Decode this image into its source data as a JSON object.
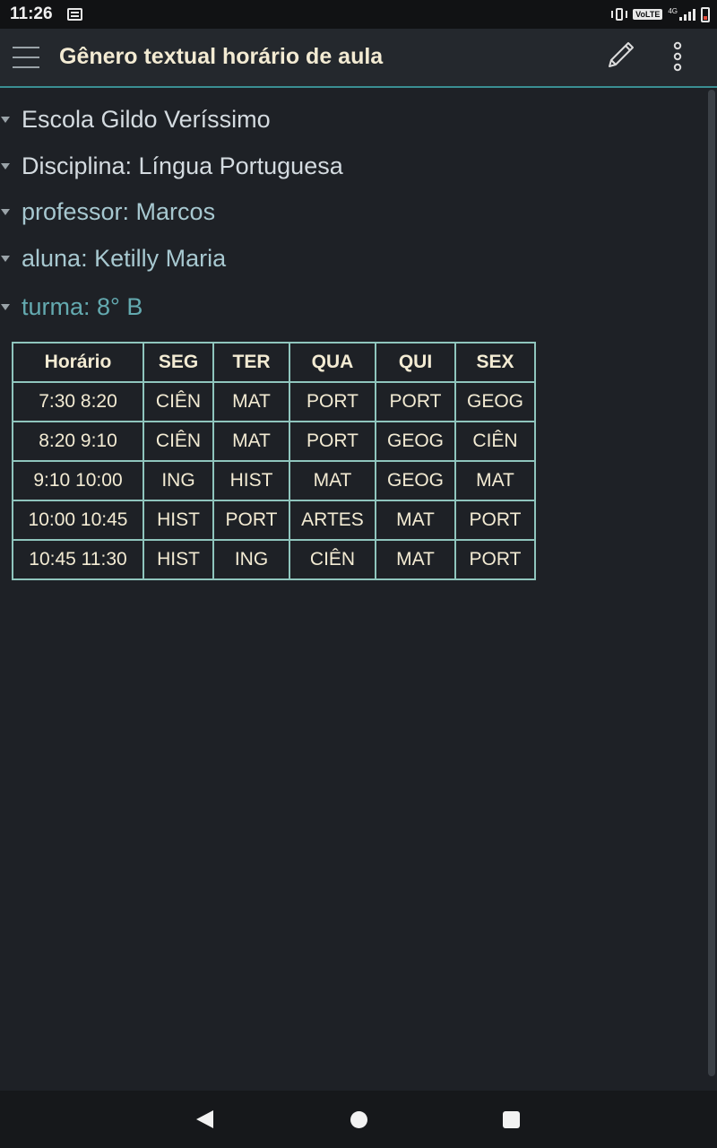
{
  "status_bar": {
    "time": "11:26",
    "volte": "VoLTE",
    "network": "4G",
    "icons": [
      "notification-icon",
      "vibrate-icon",
      "signal-icon",
      "battery-icon"
    ]
  },
  "app_bar": {
    "title": "Gênero textual horário de aula",
    "icons": [
      "menu-icon",
      "edit-icon",
      "more-vert-icon"
    ]
  },
  "bullets": [
    {
      "text": "Escola Gildo Veríssimo",
      "color": "#d4dbe0"
    },
    {
      "text": "Disciplina: Língua Portuguesa",
      "color": "#d4dbe0"
    },
    {
      "text": "professor: Marcos",
      "color": "#a7c8d0"
    },
    {
      "text": "aluna: Ketilly Maria",
      "color": "#a7c8d0"
    },
    {
      "text": "turma: 8° B",
      "color": "#64aab0"
    }
  ],
  "schedule": {
    "headers": [
      "Horário",
      "SEG",
      "TER",
      "QUA",
      "QUI",
      "SEX"
    ],
    "rows": [
      [
        "7:30 8:20",
        "CIÊN",
        "MAT",
        "PORT",
        "PORT",
        "GEOG"
      ],
      [
        "8:20 9:10",
        "CIÊN",
        "MAT",
        "PORT",
        "GEOG",
        "CIÊN"
      ],
      [
        "9:10 10:00",
        "ING",
        "HIST",
        "MAT",
        "GEOG",
        "MAT"
      ],
      [
        "10:00 10:45",
        "HIST",
        "PORT",
        "ARTES",
        "MAT",
        "PORT"
      ],
      [
        "10:45 11:30",
        "HIST",
        "ING",
        "CIÊN",
        "MAT",
        "PORT"
      ]
    ]
  },
  "colors": {
    "background": "#1e2126",
    "accent": "#3a8f92",
    "title_text": "#f3ebd3",
    "table_border": "#8fc5bd"
  },
  "nav_bar": {
    "icons": [
      "back-icon",
      "home-icon",
      "recent-apps-icon"
    ]
  }
}
